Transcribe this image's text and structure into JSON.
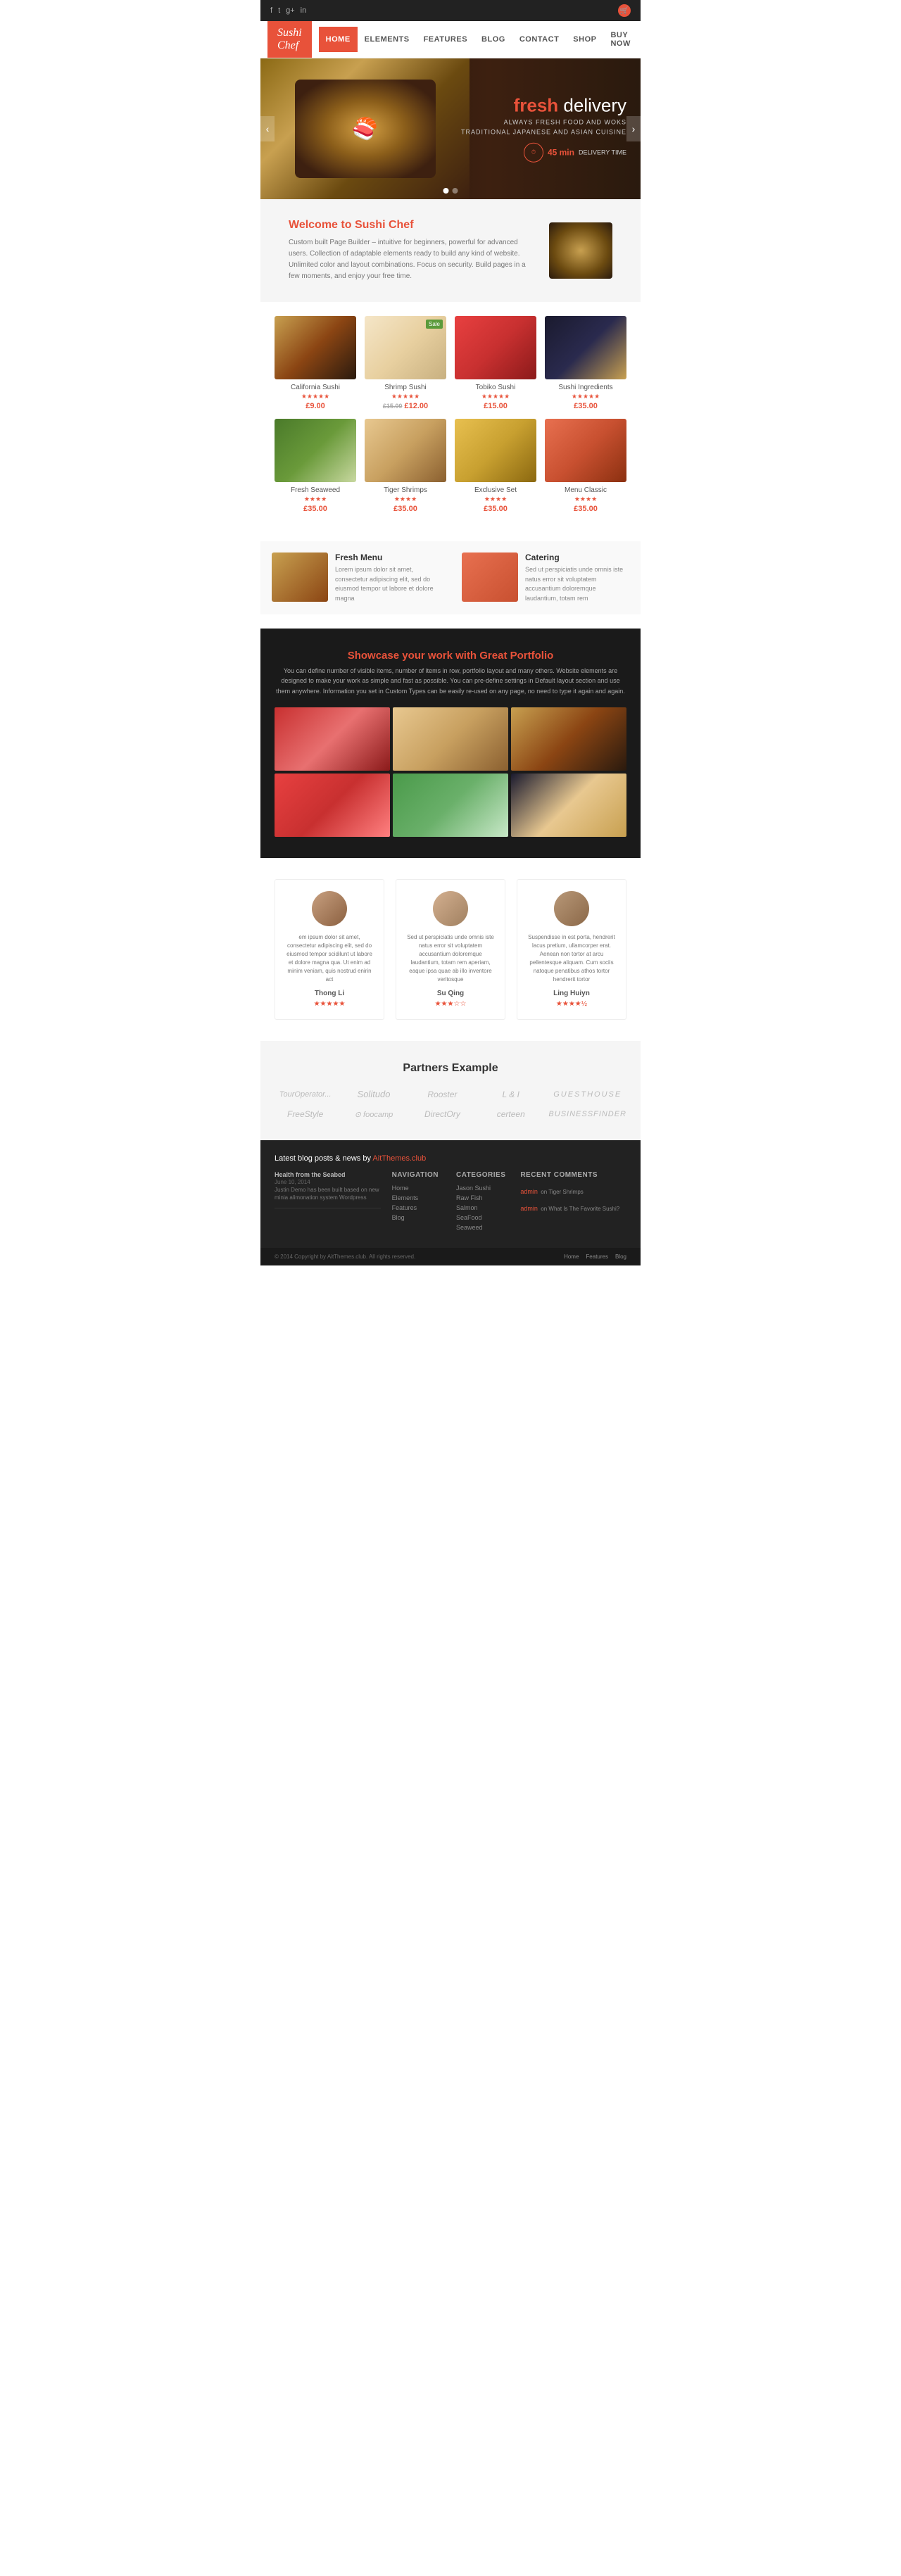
{
  "topbar": {
    "social": [
      "f",
      "t",
      "g+",
      "in"
    ],
    "cart_count": "0"
  },
  "navbar": {
    "logo": "Sushi Chef",
    "links": [
      {
        "label": "HOME",
        "active": true
      },
      {
        "label": "ELEMENTS",
        "active": false
      },
      {
        "label": "FEATURES",
        "active": false
      },
      {
        "label": "BLOG",
        "active": false
      },
      {
        "label": "CONTACT",
        "active": false
      },
      {
        "label": "SHOP",
        "active": false
      },
      {
        "label": "BUY NOW",
        "active": false
      }
    ]
  },
  "hero": {
    "subtitle1": "fresh",
    "title": "delivery",
    "tagline1": "ALWAYS FRESH FOOD AND WOKS",
    "tagline2": "TRADITIONAL JAPANESE AND ASIAN CUISINE",
    "delivery_time": "45 min",
    "delivery_label": "DELIVERY TIME"
  },
  "welcome": {
    "title_prefix": "Welcome to ",
    "title_brand": "Sushi Chef",
    "description": "Custom built Page Builder – intuitive for beginners, powerful for advanced users. Collection of adaptable elements ready to build any kind of website. Unlimited color and layout combinations. Focus on security. Build pages in a few moments, and enjoy your free time."
  },
  "products": [
    {
      "name": "California Sushi",
      "price": "£9.00",
      "old_price": "",
      "stars": "★★★★★",
      "badge": "",
      "img_class": "product-img-1"
    },
    {
      "name": "Shrimp Sushi",
      "price": "£12.00",
      "old_price": "£15.00",
      "stars": "★★★★★",
      "badge": "Sale",
      "img_class": "product-img-2"
    },
    {
      "name": "Tobiko Sushi",
      "price": "£15.00",
      "old_price": "",
      "stars": "★★★★★",
      "badge": "",
      "img_class": "product-img-3"
    },
    {
      "name": "Sushi Ingredients",
      "price": "£35.00",
      "old_price": "",
      "stars": "★★★★★",
      "badge": "",
      "img_class": "product-img-4"
    },
    {
      "name": "Fresh Seaweed",
      "price": "£35.00",
      "old_price": "",
      "stars": "★★★★",
      "badge": "",
      "img_class": "product-img-5"
    },
    {
      "name": "Tiger Shrimps",
      "price": "£35.00",
      "old_price": "",
      "stars": "★★★★",
      "badge": "",
      "img_class": "product-img-6"
    },
    {
      "name": "Exclusive Set",
      "price": "£35.00",
      "old_price": "",
      "stars": "★★★★",
      "badge": "",
      "img_class": "product-img-7"
    },
    {
      "name": "Menu Classic",
      "price": "£35.00",
      "old_price": "",
      "stars": "★★★★",
      "badge": "",
      "img_class": "product-img-8"
    }
  ],
  "features": [
    {
      "title": "Fresh Menu",
      "description": "Lorem ipsum dolor sit amet, consectetur adipiscing elit, sed do eiusmod tempor ut labore et dolore magna",
      "img_class": "feature-img-1"
    },
    {
      "title": "Catering",
      "description": "Sed ut perspiciatis unde omnis iste natus error sit voluptatem accusantium doloremque laudantium, totam rem",
      "img_class": "feature-img-2"
    }
  ],
  "portfolio": {
    "title_prefix": "Showcase your work with ",
    "title_highlight": "Great Portfolio",
    "description": "You can define number of visible items, number of items in row, portfolio layout and many others. Website elements are designed to make your work as simple and fast as possible. You can pre-define settings in Default layout section and use them anywhere. Information you set in Custom Types can be easily re-used on any page, no need to type it again and again."
  },
  "testimonials": [
    {
      "text": "em ipsum dolor sit amet, consectetur adipiscing elit, sed do eiusmod tempor scidilunt ut labore et dolore magna qua. Ut enim ad minim veniam, quis nostrud enirin act",
      "name": "Thong Li",
      "stars": "★★★★★",
      "avatar_class": "t-avatar-1"
    },
    {
      "text": "Sed ut perspiciatis unde omnis iste natus error sit voluptatem accusantium doloremque laudantium, totam rem aperiam, eaque ipsa quae ab illo inventore veritosque",
      "name": "Su Qing",
      "stars": "★★★☆☆",
      "avatar_class": "t-avatar-2"
    },
    {
      "text": "Suspendisse in est porta, hendrerit lacus pretium, ullamcorper erat. Aenean non tortor at arcu pellentesque aliquam. Cum sociis natoque penatibus athos tortor hendrerit tortor",
      "name": "Ling Huiyn",
      "stars": "★★★★½",
      "avatar_class": "t-avatar-3"
    }
  ],
  "partners": {
    "title": "Partners Example",
    "items": [
      {
        "label": "TourOperator...",
        "icon": ""
      },
      {
        "label": "Solitudo",
        "icon": ""
      },
      {
        "label": "Rooster",
        "icon": ""
      },
      {
        "label": "L & I",
        "icon": ""
      },
      {
        "label": "GUESTHOUSE",
        "icon": ""
      },
      {
        "label": "FreeStyle",
        "icon": ""
      },
      {
        "label": "⊙ foocamp",
        "icon": ""
      },
      {
        "label": "DirectOry",
        "icon": ""
      },
      {
        "label": "certeen",
        "icon": ""
      },
      {
        "label": "BUSINESSFINDER",
        "icon": ""
      }
    ]
  },
  "footer": {
    "blog_section_title": "Latest blog posts & news by AitThemes.club",
    "blog_posts": [
      {
        "title": "Health from the Seabed",
        "date": "June 10, 2014",
        "text": "Justin Demo has been built based on new minia alimonation system Wordpress"
      }
    ],
    "nav_title": "Navigation",
    "nav_links": [
      "Home",
      "Elements",
      "Features",
      "Blog"
    ],
    "categories_title": "Categories",
    "categories": [
      "Jason Sushi",
      "Raw Fish",
      "Salmon",
      "SeaFood",
      "Seaweed"
    ],
    "comments_title": "Recent Comments",
    "comments": [
      {
        "author": "admin",
        "on": "Tiger Shrimps"
      },
      {
        "author": "admin",
        "on": "What Is The Favorite Sushi?"
      }
    ],
    "copyright": "© 2014 Copyright by AitThemes.club. All rights reserved.",
    "bottom_links": [
      "Home",
      "Features",
      "Blog"
    ]
  }
}
